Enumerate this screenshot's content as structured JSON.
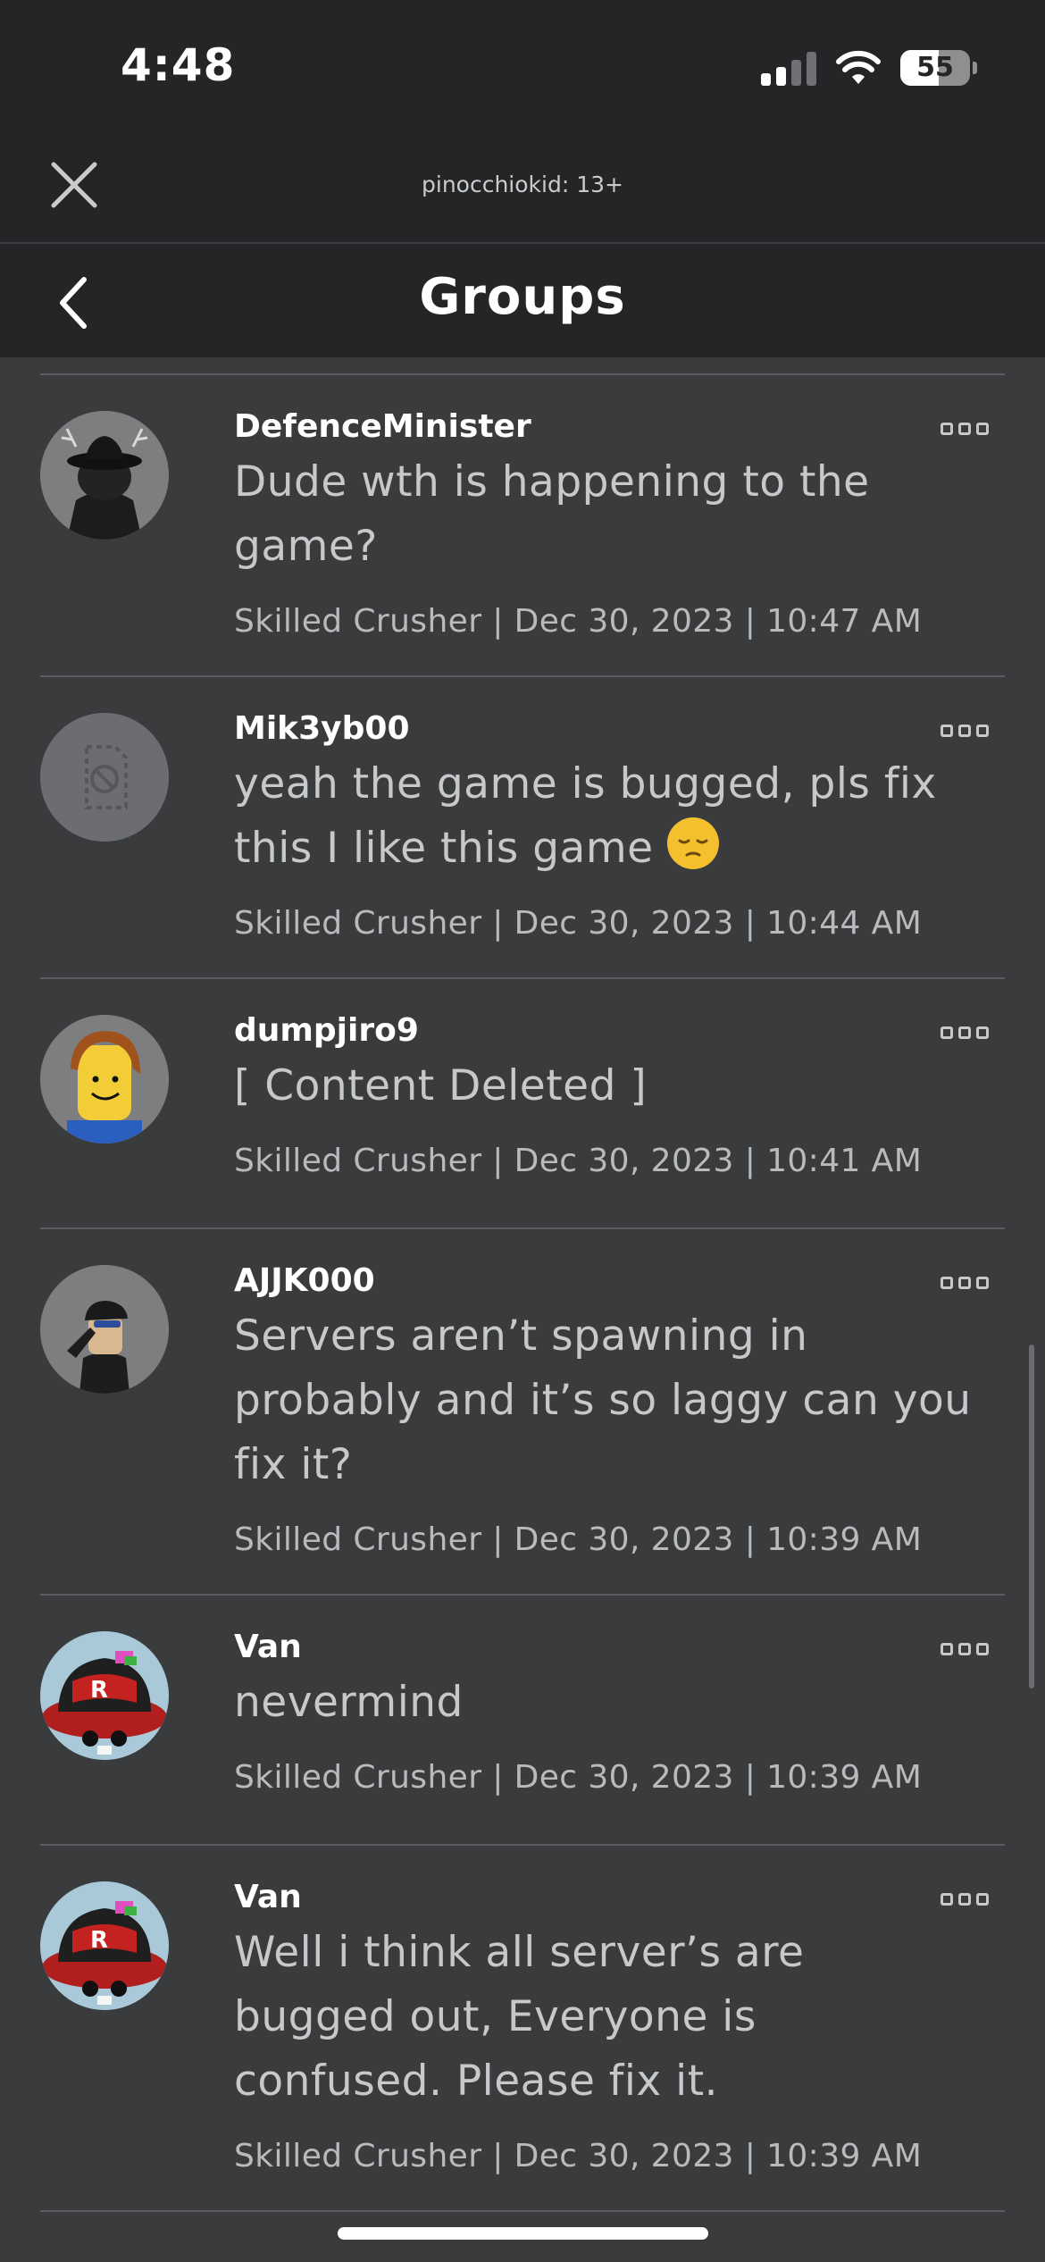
{
  "status_bar": {
    "time": "4:48",
    "battery": "55"
  },
  "webview": {
    "title": "pinocchiokid: 13+"
  },
  "nav": {
    "title": "Groups"
  },
  "posts": [
    {
      "author": "DefenceMinister",
      "body": "Dude wth is happening to the game?",
      "meta": "Skilled Crusher | Dec 30, 2023 | 10:47 AM",
      "avatar": "black-hat-antler-avatar"
    },
    {
      "author": "Mik3yb00",
      "body": "yeah the game is bugged, pls fix this I like this game",
      "emoji": "pensive-face-emoji",
      "meta": "Skilled Crusher | Dec 30, 2023 | 10:44 AM",
      "avatar": "unavailable-avatar"
    },
    {
      "author": "dumpjiro9",
      "body": "[ Content Deleted ]",
      "meta": "Skilled Crusher | Dec 30, 2023 | 10:41 AM",
      "avatar": "classic-noob-avatar"
    },
    {
      "author": "AJJK000",
      "body": "Servers aren’t spawning in probably and it’s so laggy can you fix it?",
      "meta": "Skilled Crusher | Dec 30, 2023 | 10:39 AM",
      "avatar": "saluting-cap-avatar"
    },
    {
      "author": "Van",
      "body": "nevermind",
      "meta": "Skilled Crusher | Dec 30, 2023 | 10:39 AM",
      "avatar": "red-r-cap-avatar"
    },
    {
      "author": "Van",
      "body": "Well i think all server’s are bugged out, Everyone is confused. Please fix it.",
      "meta": "Skilled Crusher | Dec 30, 2023 | 10:39 AM",
      "avatar": "red-r-cap-avatar"
    }
  ]
}
